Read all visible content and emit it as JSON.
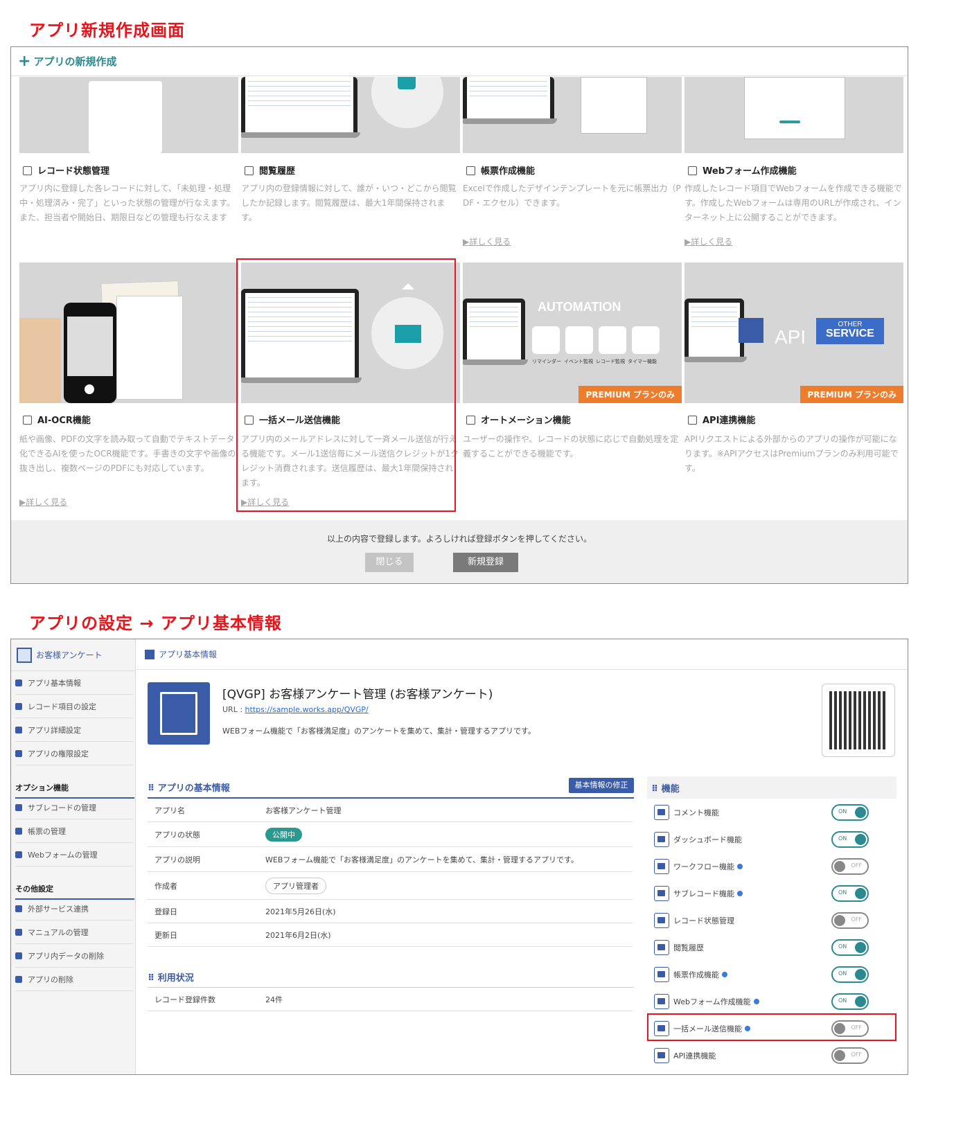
{
  "section1_title": "アプリ新規作成画面",
  "section2_title": "アプリの設定 → アプリ基本情報",
  "create_panel": {
    "header": "アプリの新規作成",
    "cards_row1": [
      {
        "title": "レコード状態管理",
        "desc": "アプリ内に登録した各レコードに対して、「未処理・処理中・処理済み・完了」といった状態の管理が行なえます。また、担当者や開始日、期限日などの管理も行なえます",
        "more": ""
      },
      {
        "title": "閲覧履歴",
        "desc": "アプリ内の登録情報に対して、誰が・いつ・どこから閲覧したか記録します。閲覧履歴は、最大1年間保持されます。",
        "more": ""
      },
      {
        "title": "帳票作成機能",
        "desc": "Excelで作成したデザインテンプレートを元に帳票出力（PDF・エクセル）できます。",
        "more": "詳しく見る"
      },
      {
        "title": "Webフォーム作成機能",
        "desc": "作成したレコード項目でWebフォームを作成できる機能です。作成したWebフォームは専用のURLが作成され、インターネット上に公開することができます。",
        "more": "詳しく見る"
      }
    ],
    "cards_row2": [
      {
        "title": "AI-OCR機能",
        "desc": "紙や画像、PDFの文字を読み取って自動でテキストデータ化できるAIを使ったOCR機能です。手書きの文字や画像の抜き出し、複数ページのPDFにも対応しています。",
        "more": "詳しく見る"
      },
      {
        "title": "一括メール送信機能",
        "desc": "アプリ内のメールアドレスに対して一斉メール送信が行える機能です。メール1送信毎にメール送信クレジットが1クレジット消費されます。送信履歴は、最大1年間保持されます。",
        "more": "詳しく見る"
      },
      {
        "title": "オートメーション機能",
        "desc": "ユーザーの操作や、レコードの状態に応じで自動処理を定義することができる機能です。",
        "more": ""
      },
      {
        "title": "API連携機能",
        "desc": "APIリクエストによる外部からのアプリの操作が可能になります。※APIアクセスはPremiumプランのみ利用可能です。",
        "more": ""
      }
    ],
    "automation_label": "AUTOMATION",
    "automation_items": [
      "リマインダー",
      "イベント監視",
      "レコード監視",
      "タイマー機能"
    ],
    "api_label": "API",
    "other_service": [
      "OTHER",
      "SERVICE"
    ],
    "premium_badge": "PREMIUM プランのみ",
    "footer_text": "以上の内容で登録します。よろしければ登録ボタンを押してください。",
    "close_button": "閉じる",
    "register_button": "新規登録"
  },
  "settings_panel": {
    "app_short": "お客様アンケート",
    "breadcrumb": "アプリ基本情報",
    "sidebar_items": [
      "アプリ基本情報",
      "レコード項目の設定",
      "アプリ詳細設定",
      "アプリの権限設定"
    ],
    "option_head": "オプション機能",
    "option_items": [
      "サブレコードの管理",
      "帳票の管理",
      "Webフォームの管理"
    ],
    "other_head": "その他設定",
    "other_items": [
      "外部サービス連携",
      "マニュアルの管理",
      "アプリ内データの削除",
      "アプリの削除"
    ],
    "app_title": "[QVGP] お客様アンケート管理 (お客様アンケート)",
    "url_label": "URL :",
    "url": "https://sample.works.app/QVGP/",
    "app_desc": "WEBフォーム機能で「お客様満足度」のアンケートを集めて、集計・管理するアプリです。",
    "basic_head": "アプリの基本情報",
    "edit_button": "基本情報の修正",
    "basic_rows": [
      {
        "k": "アプリ名",
        "v": "お客様アンケート管理"
      },
      {
        "k": "アプリの状態",
        "v": "公開中"
      },
      {
        "k": "アプリの説明",
        "v": "WEBフォーム機能で「お客様満足度」のアンケートを集めて、集計・管理するアプリです。"
      },
      {
        "k": "作成者",
        "v": "アプリ管理者"
      },
      {
        "k": "登録日",
        "v": "2021年5月26日(水)"
      },
      {
        "k": "更新日",
        "v": "2021年6月2日(水)"
      }
    ],
    "usage_head": "利用状況",
    "usage_rows": [
      {
        "k": "レコード登録件数",
        "v": "24件"
      }
    ],
    "features_head": "機能",
    "features": [
      {
        "name": "コメント機能",
        "state": "ON",
        "info": false
      },
      {
        "name": "ダッシュボード機能",
        "state": "ON",
        "info": false
      },
      {
        "name": "ワークフロー機能",
        "state": "OFF",
        "info": true
      },
      {
        "name": "サブレコード機能",
        "state": "ON",
        "info": true
      },
      {
        "name": "レコード状態管理",
        "state": "OFF",
        "info": false
      },
      {
        "name": "閲覧履歴",
        "state": "ON",
        "info": false
      },
      {
        "name": "帳票作成機能",
        "state": "ON",
        "info": true
      },
      {
        "name": "Webフォーム作成機能",
        "state": "ON",
        "info": true
      },
      {
        "name": "一括メール送信機能",
        "state": "OFF",
        "info": true
      },
      {
        "name": "API連携機能",
        "state": "OFF",
        "info": false
      }
    ],
    "highlight_color": "#e8141b",
    "accent_color": "#3a5ca8"
  }
}
